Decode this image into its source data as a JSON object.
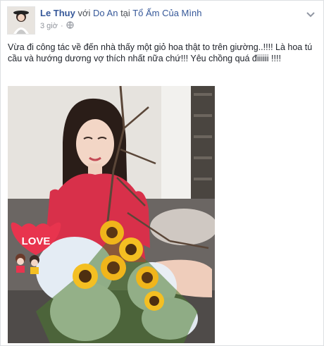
{
  "post": {
    "author": "Le Thuy",
    "with_word": "với",
    "tagged": "Do An",
    "at_word": "tại",
    "location": "Tổ Ấm Của Mình",
    "time": "3 giờ",
    "separator": "·",
    "privacy_icon": "globe-icon",
    "menu_icon": "chevron-down-icon",
    "text": "Vừa đi công tác về đến nhà thấy một giỏ hoa thật to trên giường..!!!! Là hoa tú cầu và hướng dương vợ thích nhất nữa chứ!!! Yêu chồng quá điiiiii !!!!",
    "photo_sticker": "LOVE"
  },
  "colors": {
    "link": "#365899",
    "meta": "#90949c",
    "text": "#1d2129",
    "dress": "#d8304a"
  }
}
